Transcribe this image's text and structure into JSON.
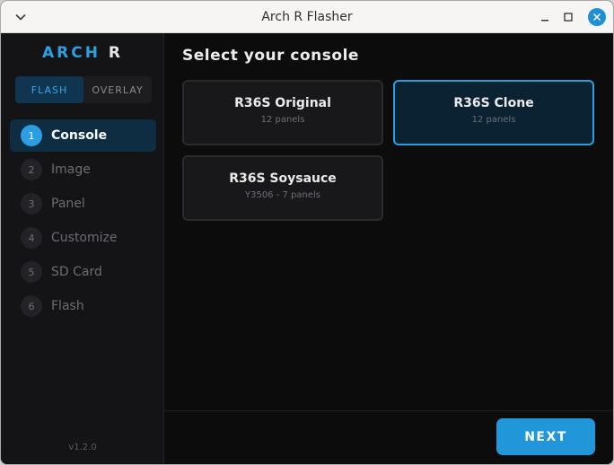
{
  "window": {
    "title": "Arch R Flasher"
  },
  "sidebar": {
    "logo_left": "ARCH",
    "logo_right": "R",
    "modes": [
      {
        "label": "FLASH",
        "active": true
      },
      {
        "label": "OVERLAY",
        "active": false
      }
    ],
    "steps": [
      {
        "num": "1",
        "label": "Console",
        "active": true
      },
      {
        "num": "2",
        "label": "Image",
        "active": false
      },
      {
        "num": "3",
        "label": "Panel",
        "active": false
      },
      {
        "num": "4",
        "label": "Customize",
        "active": false
      },
      {
        "num": "5",
        "label": "SD Card",
        "active": false
      },
      {
        "num": "6",
        "label": "Flash",
        "active": false
      }
    ],
    "version": "v1.2.0"
  },
  "main": {
    "heading": "Select your console",
    "consoles": [
      {
        "title": "R36S Original",
        "subtitle": "12 panels",
        "selected": false
      },
      {
        "title": "R36S Clone",
        "subtitle": "12 panels",
        "selected": true
      },
      {
        "title": "R36S Soysauce",
        "subtitle": "Y3506 - 7 panels",
        "selected": false
      }
    ],
    "next_label": "NEXT"
  },
  "colors": {
    "accent": "#2196d9",
    "background": "#0c0c0d",
    "sidebar": "#141416"
  },
  "icons": {
    "menu": "chevron-down-icon",
    "minimize": "minimize-icon",
    "maximize": "maximize-icon",
    "close": "close-icon"
  }
}
